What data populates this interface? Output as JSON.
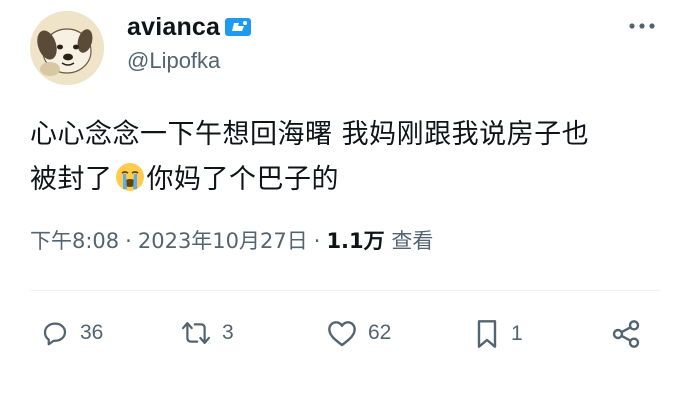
{
  "author": {
    "display_name": "avianca",
    "handle": "@Lipofka",
    "avatar_icon": "cartoon-dog-avatar",
    "badge_icon": "flag-badge-icon"
  },
  "tweet": {
    "text_line1": "心心念念一下午想回海曙 我妈刚跟我说房子也",
    "text_line2_before": "被封了",
    "emoji_icon": "loudly-crying-face-emoji",
    "text_line2_after": "你妈了个巴子的"
  },
  "meta": {
    "time": "下午8:08",
    "separator": "·",
    "date": "2023年10月27日",
    "views_count": "1.1万",
    "views_label": "查看"
  },
  "actions": {
    "reply": {
      "count": "36",
      "icon": "reply-icon"
    },
    "retweet": {
      "count": "3",
      "icon": "retweet-icon"
    },
    "like": {
      "count": "62",
      "icon": "heart-icon"
    },
    "bookmark": {
      "count": "1",
      "icon": "bookmark-icon"
    },
    "share": {
      "icon": "share-icon"
    }
  },
  "colors": {
    "text_primary": "#0f1419",
    "text_secondary": "#536471",
    "badge_blue": "#1d9bf0",
    "divider": "#eff3f4"
  }
}
